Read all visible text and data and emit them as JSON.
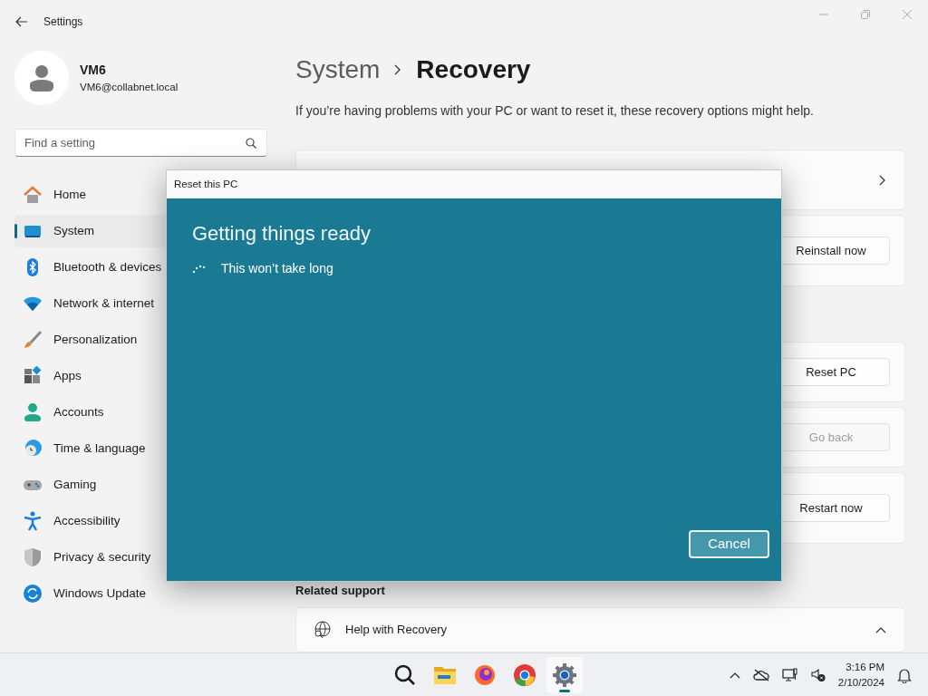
{
  "window": {
    "title": "Settings"
  },
  "user": {
    "name": "VM6",
    "email": "VM6@collabnet.local"
  },
  "search": {
    "placeholder": "Find a setting"
  },
  "sidebar": {
    "items": [
      {
        "kind": "home",
        "label": "Home",
        "selected": false
      },
      {
        "kind": "system",
        "label": "System",
        "selected": true
      },
      {
        "kind": "bluetooth",
        "label": "Bluetooth & devices",
        "selected": false
      },
      {
        "kind": "network",
        "label": "Network & internet",
        "selected": false
      },
      {
        "kind": "personalization",
        "label": "Personalization",
        "selected": false
      },
      {
        "kind": "apps",
        "label": "Apps",
        "selected": false
      },
      {
        "kind": "accounts",
        "label": "Accounts",
        "selected": false
      },
      {
        "kind": "time",
        "label": "Time & language",
        "selected": false
      },
      {
        "kind": "gaming",
        "label": "Gaming",
        "selected": false
      },
      {
        "kind": "accessibility",
        "label": "Accessibility",
        "selected": false
      },
      {
        "kind": "privacy",
        "label": "Privacy & security",
        "selected": false
      },
      {
        "kind": "update",
        "label": "Windows Update",
        "selected": false
      }
    ]
  },
  "breadcrumb": {
    "parent": "System",
    "current": "Recovery"
  },
  "description": "If you’re having problems with your PC or want to reset it, these recovery options might help.",
  "cards": [
    {
      "kind": "link"
    },
    {
      "kind": "button",
      "button": "Reinstall now",
      "disabled": false
    },
    {
      "kind": "button",
      "button": "Reset PC",
      "disabled": false
    },
    {
      "kind": "button",
      "button": "Go back",
      "disabled": true
    },
    {
      "kind": "button",
      "button": "Restart now",
      "disabled": false
    }
  ],
  "related_support": {
    "heading": "Related support",
    "items": [
      {
        "label": "Help with Recovery",
        "expanded": true
      }
    ]
  },
  "dialog": {
    "title": "Reset this PC",
    "heading": "Getting things ready",
    "status": "This won’t take long",
    "cancel": "Cancel"
  },
  "taskbar": {
    "apps": [
      {
        "kind": "search",
        "selected": false
      },
      {
        "kind": "explorer",
        "selected": false
      },
      {
        "kind": "firefox",
        "selected": false
      },
      {
        "kind": "chrome",
        "selected": false
      },
      {
        "kind": "settings",
        "selected": true
      }
    ],
    "time": "3:16 PM",
    "date": "2/10/2024"
  }
}
